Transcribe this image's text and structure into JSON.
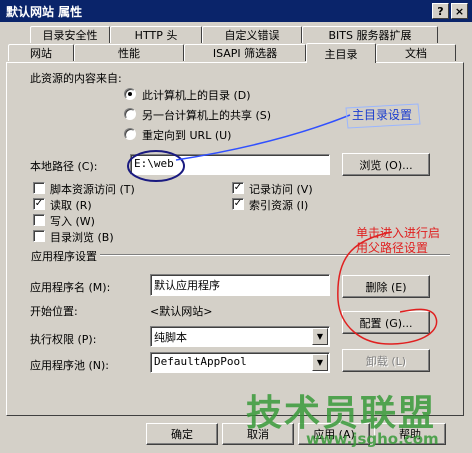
{
  "window": {
    "title": "默认网站 属性",
    "help_button": "?",
    "close_button": "×"
  },
  "tabs": {
    "row_back": [
      "目录安全性",
      "HTTP 头",
      "自定义错误",
      "BITS 服务器扩展"
    ],
    "row_front": [
      "网站",
      "性能",
      "ISAPI 筛选器",
      "主目录",
      "文档"
    ],
    "active": "主目录"
  },
  "content_source": {
    "label": "此资源的内容来自:",
    "options": [
      {
        "label": "此计算机上的目录 (D)",
        "selected": true
      },
      {
        "label": "另一台计算机上的共享 (S)",
        "selected": false
      },
      {
        "label": "重定向到 URL (U)",
        "selected": false
      }
    ]
  },
  "local_path": {
    "label": "本地路径 (C):",
    "value": "E:\\web",
    "browse_button": "浏览 (O)..."
  },
  "permissions": {
    "left": [
      {
        "label": "脚本资源访问 (T)",
        "checked": false
      },
      {
        "label": "读取 (R)",
        "checked": true
      },
      {
        "label": "写入 (W)",
        "checked": false
      },
      {
        "label": "目录浏览 (B)",
        "checked": false
      }
    ],
    "right": [
      {
        "label": "记录访问 (V)",
        "checked": true
      },
      {
        "label": "索引资源 (I)",
        "checked": true
      }
    ]
  },
  "app_settings": {
    "group_label": "应用程序设置",
    "app_name_label": "应用程序名 (M):",
    "app_name_value": "默认应用程序",
    "remove_button": "删除 (E)",
    "start_point_label": "开始位置:",
    "start_point_value": "<默认网站>",
    "config_button": "配置 (G)...",
    "exec_perm_label": "执行权限 (P):",
    "exec_perm_value": "纯脚本",
    "app_pool_label": "应用程序池 (N):",
    "app_pool_value": "DefaultAppPool",
    "unload_button": "卸载 (L)"
  },
  "footer": {
    "ok_button": "确定",
    "cancel_button": "取消",
    "apply_button": "应用 (A)",
    "help_button": "帮助"
  },
  "annotations": {
    "home_dir_note": "主目录设置",
    "parent_path_note_line1": "单击进入进行启",
    "parent_path_note_line2": "用父路径设置",
    "watermark_title": "技术员联盟",
    "watermark_url": "www.jsgho.com"
  },
  "colors": {
    "dialog_bg": "#d4d0c8",
    "titlebar_bg": "#0a246a",
    "annotation_blue": "#1a3ccf",
    "annotation_red": "#e02020",
    "watermark_green": "#3a9a3a"
  }
}
